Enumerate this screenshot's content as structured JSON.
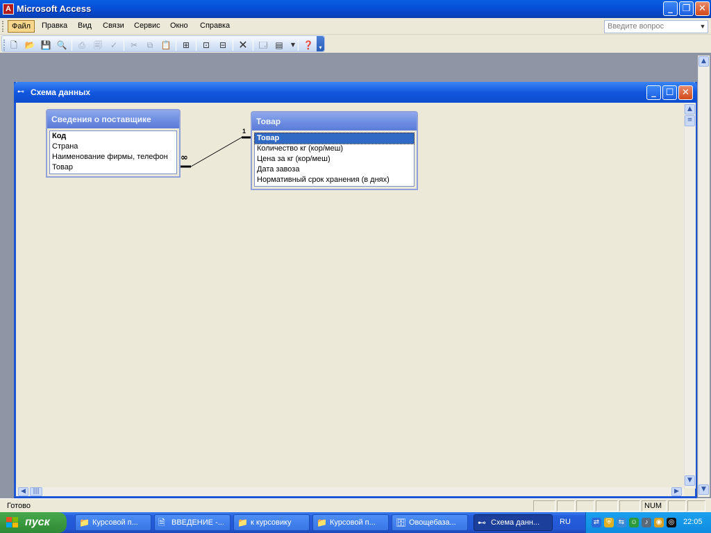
{
  "app": {
    "title": "Microsoft Access"
  },
  "help_box": {
    "placeholder": "Введите вопрос"
  },
  "menu": [
    {
      "label": "Файл"
    },
    {
      "label": "Правка"
    },
    {
      "label": "Вид"
    },
    {
      "label": "Связи"
    },
    {
      "label": "Сервис"
    },
    {
      "label": "Окно"
    },
    {
      "label": "Справка"
    }
  ],
  "toolbar_icons": [
    "new-icon",
    "open-icon",
    "save-icon",
    "file-search-icon",
    "print-icon",
    "print-preview-icon",
    "spelling-icon",
    "cut-icon",
    "copy-icon",
    "paste-icon",
    "show-table-icon",
    "show-direct-icon",
    "show-all-icon",
    "delete-icon",
    "database-window-icon",
    "new-object-icon",
    "help-icon"
  ],
  "child_window": {
    "title": "Схема данных"
  },
  "tables": [
    {
      "name": "Сведения о поставщике",
      "fields": [
        "Код",
        "Страна",
        "Наименование фирмы, телефон",
        "Товар"
      ],
      "key_index": 0
    },
    {
      "name": "Товар",
      "fields": [
        "Товар",
        "Количество кг (кор/меш)",
        "Цена за кг (кор/меш)",
        "Дата завоза",
        "Нормативный срок хранения (в днях)"
      ],
      "selected_index": 0
    }
  ],
  "relationship": {
    "many_label": "∞",
    "one_label": "1"
  },
  "statusbar": {
    "text": "Готово",
    "num": "NUM"
  },
  "taskbar": {
    "start_label": "пуск",
    "tasks": [
      "Курсовой п...",
      "ВВЕДЕНИЕ -...",
      "к курсовику",
      "Курсовой п...",
      "Овощебаза...",
      "Схема данн..."
    ],
    "lang": "RU",
    "clock": "22:05"
  },
  "colors": {
    "titlebar": "#0550d8",
    "selection": "#316ac5",
    "start_button": "#3c9a41"
  }
}
